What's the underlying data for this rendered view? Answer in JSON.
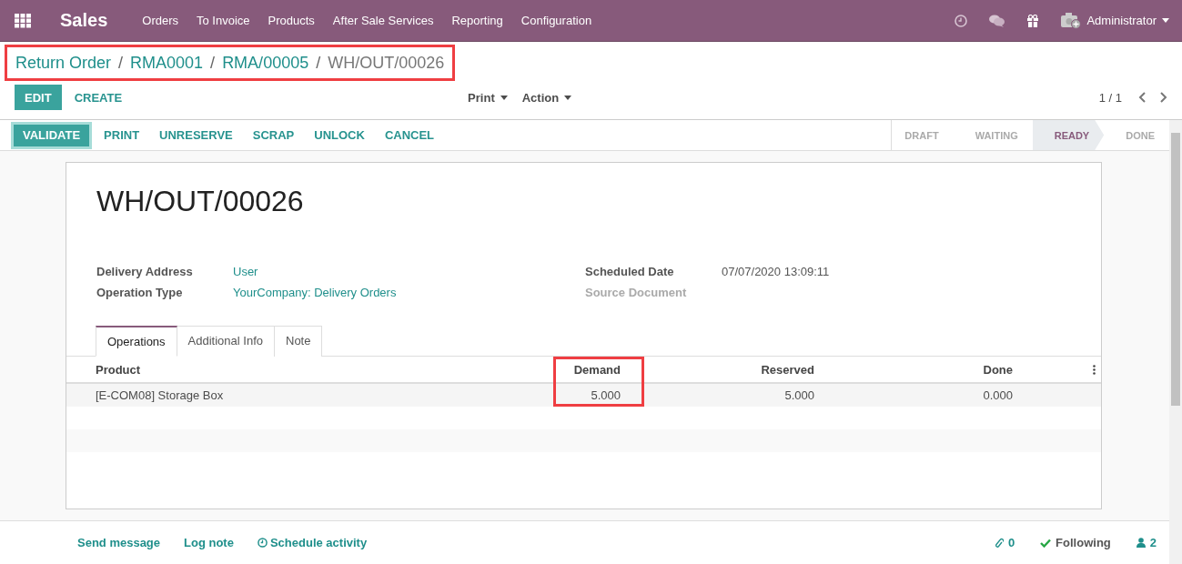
{
  "navbar": {
    "app": "Sales",
    "menus": [
      "Orders",
      "To Invoice",
      "Products",
      "After Sale Services",
      "Reporting",
      "Configuration"
    ],
    "user": "Administrator"
  },
  "breadcrumbs": {
    "highlighted": true,
    "separator": "/",
    "items": [
      {
        "label": "Return Order",
        "current": false
      },
      {
        "label": "RMA0001",
        "current": false
      },
      {
        "label": "RMA/00005",
        "current": false
      },
      {
        "label": "WH/OUT/00026",
        "current": true
      }
    ]
  },
  "control": {
    "buttons": [
      {
        "label": "EDIT",
        "kind": "primary"
      },
      {
        "label": "CREATE",
        "kind": "link"
      }
    ],
    "dropdowns": [
      "Print",
      "Action"
    ],
    "pager": "1 / 1"
  },
  "statusbar": {
    "buttons": [
      {
        "label": "VALIDATE",
        "kind": "primary"
      },
      {
        "label": "PRINT",
        "kind": "link"
      },
      {
        "label": "UNRESERVE",
        "kind": "link"
      },
      {
        "label": "SCRAP",
        "kind": "link"
      },
      {
        "label": "UNLOCK",
        "kind": "link"
      },
      {
        "label": "CANCEL",
        "kind": "link"
      }
    ],
    "stages": [
      {
        "label": "DRAFT",
        "selected": false
      },
      {
        "label": "WAITING",
        "selected": false
      },
      {
        "label": "READY",
        "selected": true
      },
      {
        "label": "DONE",
        "selected": false
      }
    ]
  },
  "form": {
    "title": "WH/OUT/00026",
    "fields_left": [
      {
        "label": "Delivery Address",
        "value": "User"
      },
      {
        "label": "Operation Type",
        "value": "YourCompany: Delivery Orders"
      }
    ],
    "fields_right": [
      {
        "label": "Scheduled Date",
        "value": "07/07/2020 13:09:11"
      },
      {
        "label": "Source Document"
      }
    ],
    "tabs": [
      {
        "label": "Operations",
        "selected": true
      },
      {
        "label": "Additional Info",
        "selected": false
      },
      {
        "label": "Note",
        "selected": false
      }
    ],
    "table": {
      "columns": [
        {
          "label": "Product",
          "highlighted": false
        },
        {
          "label": "Demand",
          "highlighted": true
        },
        {
          "label": "Reserved",
          "highlighted": false
        },
        {
          "label": "Done",
          "highlighted": false
        }
      ],
      "rows": [
        [
          "[E-COM08] Storage Box",
          "5.000",
          "5.000",
          "0.000"
        ]
      ]
    }
  },
  "chatter": {
    "actions": [
      "Send message",
      "Log note",
      "Schedule activity"
    ],
    "attachments": "0",
    "follow": "Following",
    "followers": "2"
  }
}
